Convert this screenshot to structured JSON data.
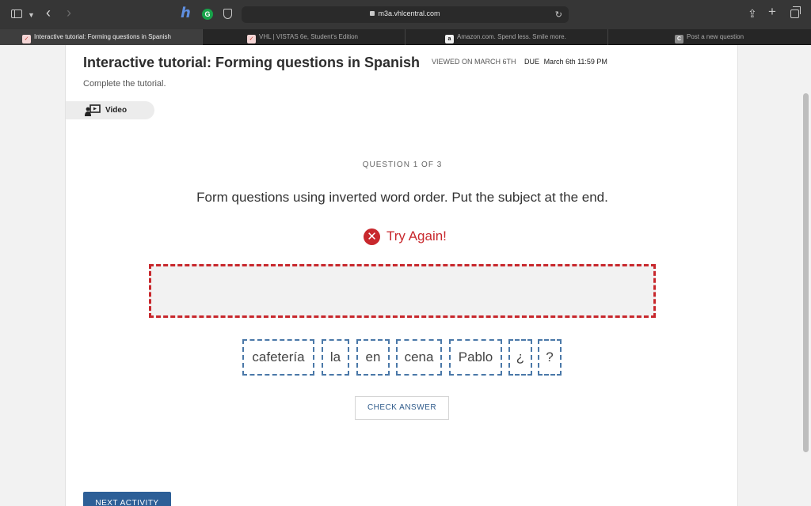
{
  "browser": {
    "url": "m3a.vhlcentral.com",
    "tabs": [
      {
        "label": "Interactive tutorial: Forming questions in Spanish",
        "favicon": "vhl-icon",
        "active": true
      },
      {
        "label": "VHL | VISTAS 6e, Student's Edition",
        "favicon": "vhl-icon",
        "active": false
      },
      {
        "label": "Amazon.com. Spend less. Smile more.",
        "favicon": "amazon-icon",
        "active": false
      },
      {
        "label": "Post a new question",
        "favicon": "chegg-icon",
        "active": false
      }
    ]
  },
  "header": {
    "title": "Interactive tutorial: Forming questions in Spanish",
    "viewed": "VIEWED ON MARCH 6TH",
    "due_label": "DUE",
    "due_date": "March 6th 11:59 PM",
    "subtitle": "Complete the tutorial."
  },
  "video": {
    "label": "Video"
  },
  "question": {
    "counter": "QUESTION 1 OF 3",
    "prompt": "Form questions using inverted word order. Put the subject at the end.",
    "feedback": "Try Again!",
    "word_tiles": [
      "cafetería",
      "la",
      "en",
      "cena",
      "Pablo",
      "¿",
      "?"
    ]
  },
  "actions": {
    "check_answer": "CHECK ANSWER",
    "next_activity": "NEXT ACTIVITY"
  },
  "colors": {
    "error_red": "#c8282d",
    "tile_blue": "#4a78a8",
    "button_blue": "#2d5f97"
  }
}
